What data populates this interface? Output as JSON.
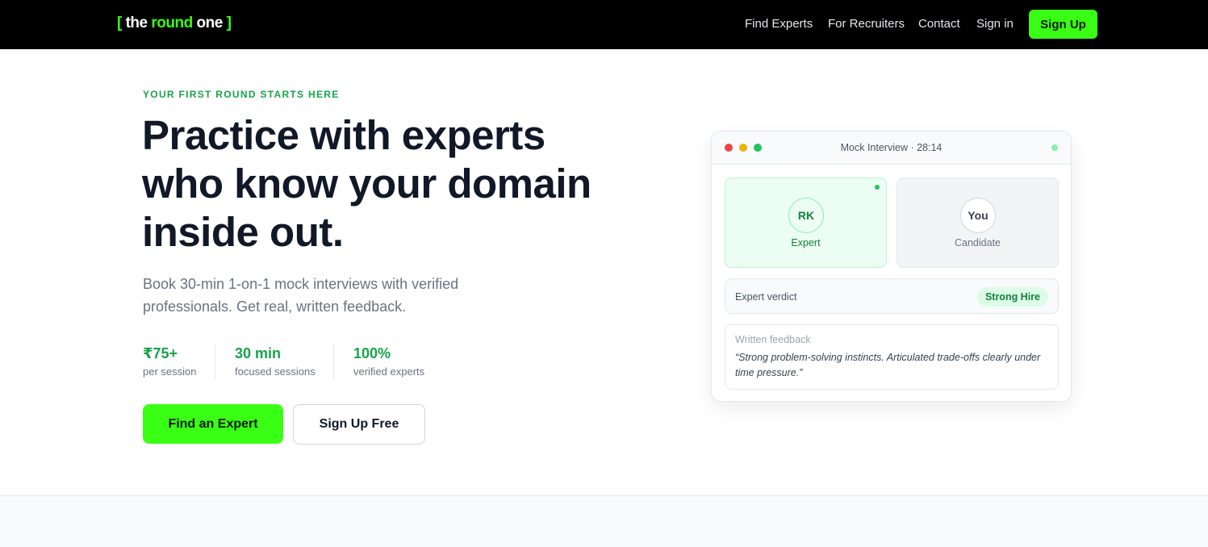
{
  "brand": {
    "open_bracket": "[",
    "word1": "the",
    "word2": "round",
    "word3": "one",
    "close_bracket": "]"
  },
  "nav": {
    "links": [
      "Find Experts",
      "For Recruiters",
      "Contact",
      "Sign in"
    ],
    "signup_label": "Sign Up"
  },
  "hero": {
    "eyebrow": "YOUR FIRST ROUND STARTS HERE",
    "headline": "Practice with experts who know your domain inside out.",
    "subtext": "Book 30-min 1-on-1 mock interviews with verified professionals. Get real, written feedback.",
    "stats": [
      {
        "value": "₹75+",
        "label": "per session"
      },
      {
        "value": "30 min",
        "label": "focused sessions"
      },
      {
        "value": "100%",
        "label": "verified experts"
      }
    ],
    "primary_cta": "Find an Expert",
    "secondary_cta": "Sign Up Free"
  },
  "card": {
    "title": "Mock Interview · 28:14",
    "expert": {
      "initials": "RK",
      "role": "Expert"
    },
    "candidate": {
      "initials": "You",
      "role": "Candidate"
    },
    "verdict_label": "Expert verdict",
    "verdict_value": "Strong Hire",
    "feedback_label": "Written feedback",
    "feedback_text": "“Strong problem-solving instincts. Articulated trade-offs clearly under time pressure.”"
  },
  "colors": {
    "accent": "#39ff14",
    "brand_green": "#16a34a",
    "window_red": "#ef4444",
    "window_yellow": "#eab308",
    "window_green": "#22c55e"
  }
}
